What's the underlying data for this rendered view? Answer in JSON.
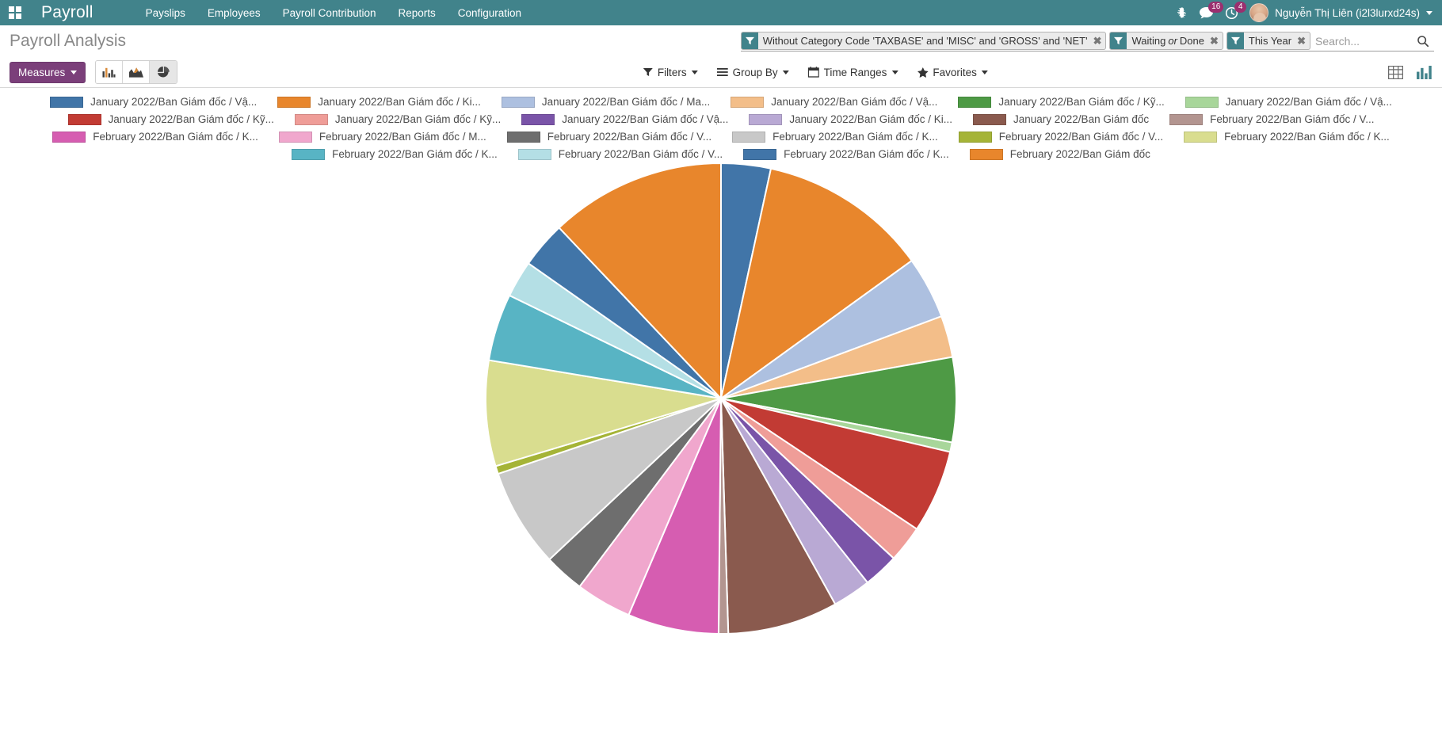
{
  "navbar": {
    "apps_icon": "apps-grid-icon",
    "brand": "Payroll",
    "menu": [
      {
        "label": "Payslips"
      },
      {
        "label": "Employees"
      },
      {
        "label": "Payroll Contribution"
      },
      {
        "label": "Reports"
      },
      {
        "label": "Configuration"
      }
    ],
    "debug_icon": "bug-icon",
    "messages": {
      "icon": "chat-icon",
      "count": "16"
    },
    "activities": {
      "icon": "clock-icon",
      "count": "4"
    },
    "user": {
      "avatar": "user-avatar",
      "name": "Nguyễn Thị Liên (i2l3lurxd24s)"
    },
    "accent_color": "#41838b"
  },
  "control_panel": {
    "breadcrumb": "Payroll Analysis",
    "facets": [
      {
        "icon": "filter-icon",
        "values": [
          "Without Category Code 'TAXBASE' and 'MISC' and 'GROSS' and 'NET'"
        ],
        "separator": "",
        "remove": "✖"
      },
      {
        "icon": "filter-icon",
        "values": [
          "Waiting",
          "Done"
        ],
        "separator": "or",
        "remove": "✖"
      },
      {
        "icon": "filter-icon",
        "values": [
          "This Year"
        ],
        "separator": "",
        "remove": "✖"
      }
    ],
    "search": {
      "placeholder": "Search...",
      "value": "",
      "icon": "search-icon"
    },
    "measures_label": "Measures",
    "chart_type_buttons": [
      {
        "name": "bar-chart",
        "icon": "bar-chart-icon",
        "active": false
      },
      {
        "name": "line-chart",
        "icon": "area-chart-icon",
        "active": false
      },
      {
        "name": "pie-chart",
        "icon": "pie-chart-icon",
        "active": true
      }
    ],
    "menus": [
      {
        "icon": "filter-icon",
        "label": "Filters"
      },
      {
        "icon": "bars-icon",
        "label": "Group By"
      },
      {
        "icon": "calendar-icon",
        "label": "Time Ranges"
      },
      {
        "icon": "star-icon",
        "label": "Favorites"
      }
    ],
    "view_switcher": [
      {
        "name": "pivot-view",
        "icon": "table-icon",
        "active": false
      },
      {
        "name": "graph-view",
        "icon": "graph-icon",
        "active": true
      }
    ]
  },
  "chart_data": {
    "type": "pie",
    "title": "Payroll Analysis",
    "grid": false,
    "legend_position": "top",
    "labels": [
      "January 2022/Ban Giám đốc / Vậ...",
      "January 2022/Ban Giám đốc / Ki...",
      "January 2022/Ban Giám đốc / Ma...",
      "January 2022/Ban Giám đốc / Vậ...",
      "January 2022/Ban Giám đốc / Kỹ...",
      "January 2022/Ban Giám đốc / Vậ...",
      "January 2022/Ban Giám đốc / Kỹ...",
      "January 2022/Ban Giám đốc / Kỹ...",
      "January 2022/Ban Giám đốc / Vậ...",
      "January 2022/Ban Giám đốc / Ki...",
      "January 2022/Ban Giám đốc",
      "February 2022/Ban Giám đốc / V...",
      "February 2022/Ban Giám đốc / K...",
      "February 2022/Ban Giám đốc / M...",
      "February 2022/Ban Giám đốc / V...",
      "February 2022/Ban Giám đốc / K...",
      "February 2022/Ban Giám đốc / V...",
      "February 2022/Ban Giám đốc / K...",
      "February 2022/Ban Giám đốc / K...",
      "February 2022/Ban Giám đốc / V...",
      "February 2022/Ban Giám đốc / K...",
      "February 2022/Ban Giám đốc"
    ],
    "colors": [
      "#4175a8",
      "#e8862c",
      "#adc0e0",
      "#f3be89",
      "#4e9a45",
      "#a8d69a",
      "#c23b34",
      "#ef9d98",
      "#7a54a8",
      "#b9a9d4",
      "#8a5a4e",
      "#b39590",
      "#d65db1",
      "#f0a7cd",
      "#6e6e6e",
      "#c8c8c8",
      "#a5b437",
      "#d9dd8f",
      "#58b4c4",
      "#b4dfe5",
      "#4175a8",
      "#e8862c"
    ],
    "values": [
      3.1,
      10.6,
      3.9,
      2.6,
      5.3,
      0.6,
      5.2,
      2.3,
      2.2,
      2.4,
      6.9,
      0.6,
      5.7,
      3.5,
      2.5,
      6.2,
      0.5,
      6.6,
      4.2,
      2.3,
      2.9,
      11.0
    ],
    "unit": "%"
  }
}
